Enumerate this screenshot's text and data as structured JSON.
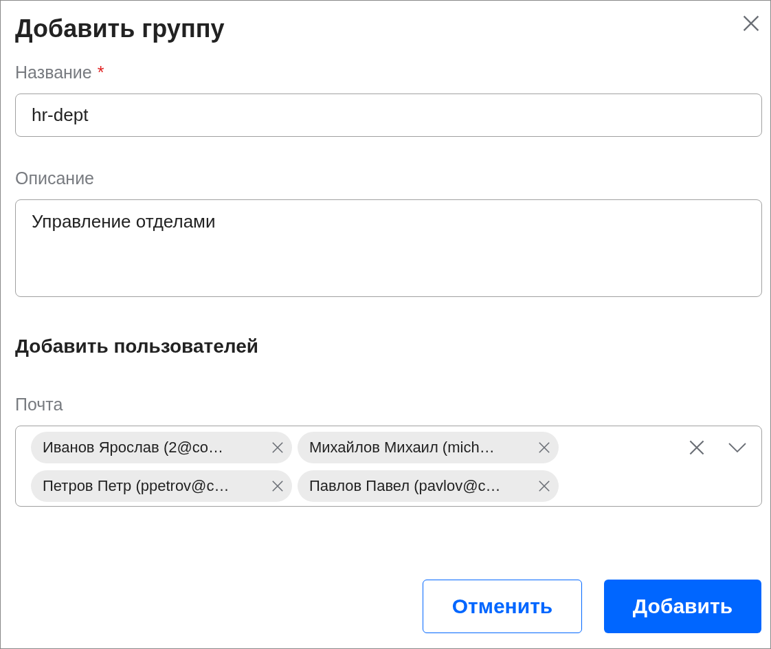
{
  "dialog": {
    "title": "Добавить группу"
  },
  "name_field": {
    "label": "Название",
    "required_mark": "*",
    "value": "hr-dept"
  },
  "description_field": {
    "label": "Описание",
    "value": "Управление отделами"
  },
  "users_section": {
    "heading": "Добавить пользователей"
  },
  "email_field": {
    "label": "Почта",
    "chips": [
      {
        "label": "Иванов Ярослав (2@co…"
      },
      {
        "label": "Михайлов Михаил (mich…"
      },
      {
        "label": "Петров Петр (ppetrov@c…"
      },
      {
        "label": "Павлов Павел (pavlov@c…"
      }
    ]
  },
  "buttons": [
    {
      "label": "Отменить",
      "kind": "secondary"
    },
    {
      "label": "Добавить",
      "kind": "primary"
    }
  ]
}
